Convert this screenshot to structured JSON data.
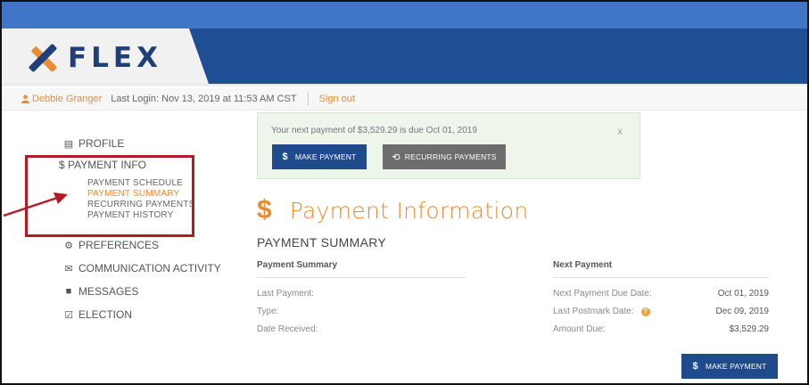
{
  "brand": {
    "name": "FLEX"
  },
  "userbar": {
    "user_name": "Debbie Granger",
    "last_login": "Last Login: Nov 13, 2019 at 11:53 AM CST",
    "sign_out": "Sign out"
  },
  "sidebar": {
    "items": [
      {
        "label": "PROFILE",
        "icon": "id-card-icon"
      },
      {
        "label": "$ PAYMENT INFO",
        "icon": "dollar-icon"
      },
      {
        "label": "PREFERENCES",
        "icon": "gears-icon"
      },
      {
        "label": "COMMUNICATION ACTIVITY",
        "icon": "envelope-icon"
      },
      {
        "label": "MESSAGES",
        "icon": "chat-bubble-icon"
      },
      {
        "label": "ELECTION",
        "icon": "checkbox-icon"
      }
    ],
    "payment_sub_items": [
      {
        "label": "PAYMENT SCHEDULE"
      },
      {
        "label": "PAYMENT SUMMARY"
      },
      {
        "label": "RECURRING PAYMENTS"
      },
      {
        "label": "PAYMENT HISTORY"
      }
    ]
  },
  "alert": {
    "text": "Your next payment of $3,529.29 is due Oct 01, 2019",
    "close": "x",
    "make_payment": "MAKE PAYMENT",
    "recurring_payments": "RECURRING PAYMENTS"
  },
  "main": {
    "title_icon": "$",
    "title": "Payment Information",
    "section_heading": "PAYMENT SUMMARY",
    "left_column": {
      "heading": "Payment Summary",
      "rows": [
        {
          "label": "Last Payment:"
        },
        {
          "label": "Type:"
        },
        {
          "label": "Date Received:"
        }
      ]
    },
    "right_column": {
      "heading": "Next Payment",
      "rows": [
        {
          "label": "Next Payment Due Date:",
          "value": "Oct 01, 2019"
        },
        {
          "label": "Last Postmark Date:",
          "value": "Dec 09, 2019",
          "help": "?"
        },
        {
          "label": "Amount Due:",
          "value": "$3,529.29"
        }
      ]
    },
    "make_payment": "MAKE PAYMENT"
  },
  "colors": {
    "accent_orange": "#e98c34",
    "brand_blue": "#1f4e95",
    "button_blue": "#1f4a8c",
    "highlight_red": "#b01c24"
  }
}
